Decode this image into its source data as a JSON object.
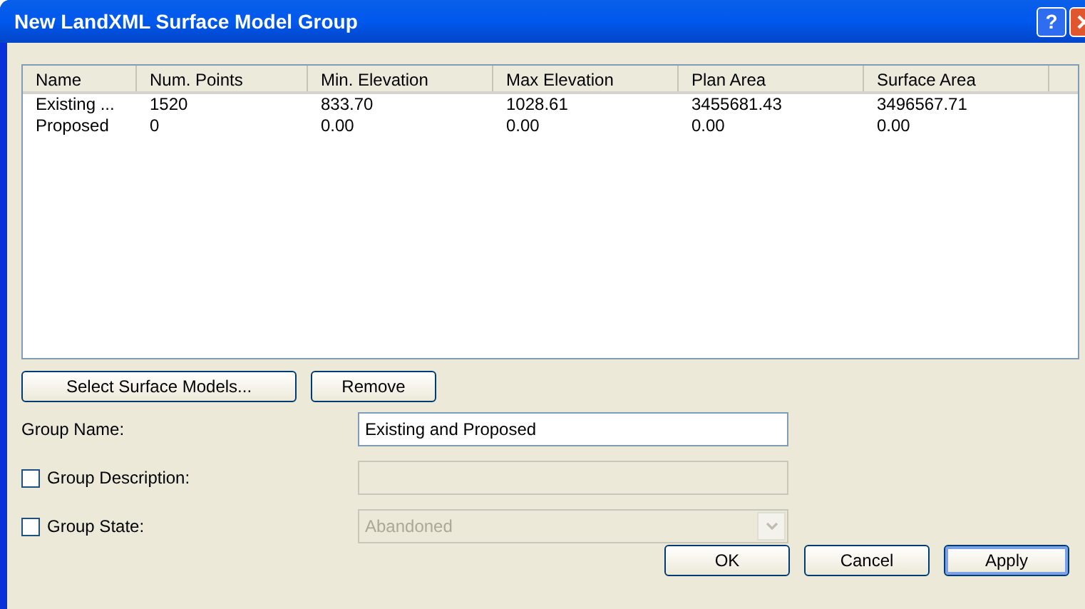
{
  "window": {
    "title": "New LandXML Surface Model Group"
  },
  "title_buttons": [
    "?"
  ],
  "table": {
    "columns": [
      "Name",
      "Num. Points",
      "Min. Elevation",
      "Max Elevation",
      "Plan Area",
      "Surface Area"
    ],
    "rows": [
      [
        "Existing ...",
        "1520",
        "833.70",
        "1028.61",
        "3455681.43",
        "3496567.71"
      ],
      [
        "Proposed",
        "0",
        "0.00",
        "0.00",
        "0.00",
        "0.00"
      ]
    ]
  },
  "list_buttons": [
    "Select Surface Models...",
    "Remove"
  ],
  "fields": [
    {
      "kind": "text",
      "label": "Group Name:",
      "value": "Existing and Proposed",
      "disabled": false
    },
    {
      "kind": "checktext",
      "label": "Group Description:",
      "checked": false,
      "disabled": true
    },
    {
      "kind": "checkcombo",
      "label": "Group State:",
      "checked": false,
      "value": "Abandoned",
      "disabled": true
    }
  ],
  "buttons": [
    {
      "label": "OK",
      "default": false
    },
    {
      "label": "Cancel",
      "default": false
    },
    {
      "label": "Apply",
      "default": true
    }
  ]
}
